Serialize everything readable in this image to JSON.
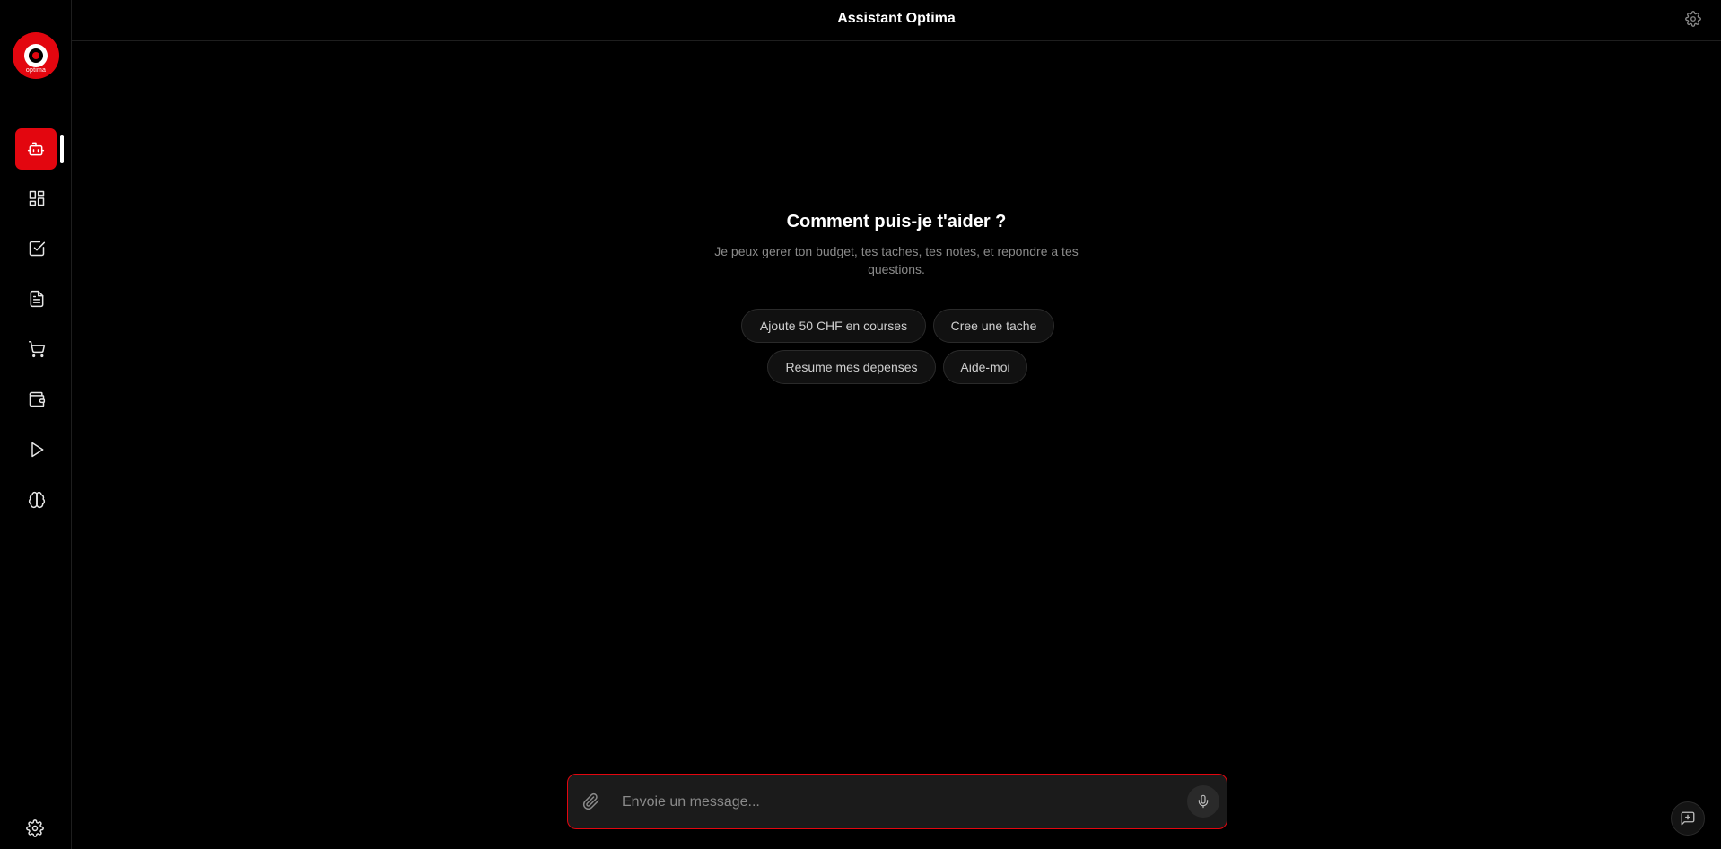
{
  "app": {
    "title": "Assistant Optima",
    "logo_text": "optima"
  },
  "colors": {
    "accent": "#e3060f",
    "background": "#000000",
    "muted_text": "#8a8a8a"
  },
  "sidebar": {
    "items": [
      {
        "icon": "bot-icon",
        "active": true
      },
      {
        "icon": "dashboard-icon",
        "active": false
      },
      {
        "icon": "checkbox-icon",
        "active": false
      },
      {
        "icon": "notes-icon",
        "active": false
      },
      {
        "icon": "cart-icon",
        "active": false
      },
      {
        "icon": "wallet-icon",
        "active": false
      },
      {
        "icon": "play-icon",
        "active": false
      },
      {
        "icon": "brain-icon",
        "active": false
      }
    ],
    "footer_icon": "gear-icon"
  },
  "header": {
    "settings_icon": "gear-icon"
  },
  "welcome": {
    "title": "Comment puis-je t'aider ?",
    "subtitle": "Je peux gerer ton budget, tes taches, tes notes, et repondre a tes questions."
  },
  "suggestions": [
    "Ajoute 50 CHF en courses",
    "Cree une tache",
    "Resume mes depenses",
    "Aide-moi"
  ],
  "composer": {
    "placeholder": "Envoie un message...",
    "attach_icon": "paperclip-icon",
    "mic_icon": "mic-icon"
  },
  "new_chat": {
    "icon": "new-chat-icon"
  }
}
